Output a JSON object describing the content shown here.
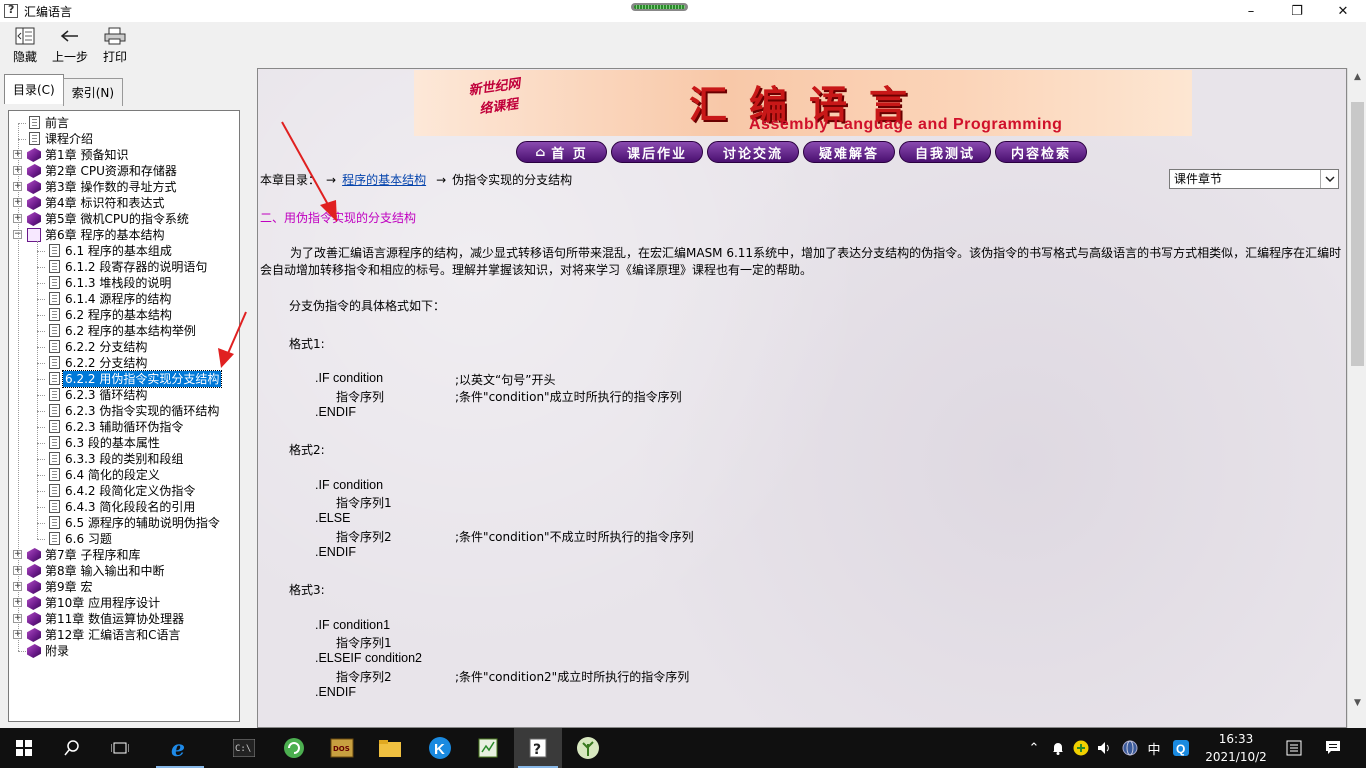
{
  "window": {
    "title": "汇编语言"
  },
  "toolbar": {
    "hide_label": "隐藏",
    "back_label": "上一步",
    "print_label": "打印"
  },
  "tabs": {
    "contents": "目录(C)",
    "index": "索引(N)"
  },
  "tree": {
    "items": [
      "前言",
      "课程介绍",
      "第1章 预备知识",
      "第2章 CPU资源和存储器",
      "第3章 操作数的寻址方式",
      "第4章 标识符和表达式",
      "第5章 微机CPU的指令系统",
      "第6章 程序的基本结构",
      "6.1 程序的基本组成",
      "6.1.2 段寄存器的说明语句",
      "6.1.3 堆栈段的说明",
      "6.1.4 源程序的结构",
      "6.2 程序的基本结构",
      "6.2 程序的基本结构举例",
      "6.2.2 分支结构",
      "6.2.2 分支结构",
      "6.2.2 用伪指令实现分支结构",
      "6.2.3 循环结构",
      "6.2.3 伪指令实现的循环结构",
      "6.2.3 辅助循环伪指令",
      "6.3 段的基本属性",
      "6.3.3 段的类别和段组",
      "6.4 简化的段定义",
      "6.4.2 段简化定义伪指令",
      "6.4.3 简化段段名的引用",
      "6.5 源程序的辅助说明伪指令",
      "6.6 习题",
      "第7章 子程序和库",
      "第8章 输入输出和中断",
      "第9章 宏",
      "第10章 应用程序设计",
      "第11章 数值运算协处理器",
      "第12章 汇编语言和C语言",
      "附录"
    ]
  },
  "banner": {
    "side_line1": "新世纪网",
    "side_line2": "络课程",
    "title": "汇编语言",
    "subtitle": "Assembly Language and Programming"
  },
  "nav": {
    "home": "首 页",
    "homework": "课后作业",
    "discussion": "讨论交流",
    "qa": "疑难解答",
    "selftest": "自我测试",
    "search": "内容检索"
  },
  "breadcrumb": {
    "prefix": "本章目录：",
    "arrow": "→",
    "link": "程序的基本结构",
    "current": "伪指令实现的分支结构"
  },
  "select": {
    "value": "课件章节"
  },
  "content": {
    "heading": "二、用伪指令实现的分支结构",
    "para1": "为了改善汇编语言源程序的结构，减少显式转移语句所带来混乱，在宏汇编MASM 6.11系统中，增加了表达分支结构的伪指令。该伪指令的书写格式与高级语言的书写方式相类似，汇编程序在汇编时会自动增加转移指令和相应的标号。理解并掌握该知识，对将来学习《编译原理》课程也有一定的帮助。",
    "intro": "分支伪指令的具体格式如下：",
    "fmt1": "格式1:",
    "fmt1_if": ".IF condition",
    "fmt1_if_comment": ";以英文“句号”开头",
    "fmt1_seq": "指令序列",
    "fmt1_seq_comment": ";条件\"condition\"成立时所执行的指令序列",
    "fmt1_endif": ".ENDIF",
    "fmt2": "格式2:",
    "fmt2_if": ".IF condition",
    "fmt2_seq1": "指令序列1",
    "fmt2_else": ".ELSE",
    "fmt2_seq2": "指令序列2",
    "fmt2_seq2_comment": ";条件\"condition\"不成立时所执行的指令序列",
    "fmt2_endif": ".ENDIF",
    "fmt3": "格式3:",
    "fmt3_if": ".IF condition1",
    "fmt3_seq1": "指令序列1",
    "fmt3_elseif": ".ELSEIF condition2",
    "fmt3_seq2": "指令序列2",
    "fmt3_seq2_comment": ";条件\"condition2\"成立时所执行的指令序列",
    "fmt3_endif": ".ENDIF"
  },
  "tray": {
    "ime": "中",
    "time": "16:33",
    "date": "2021/10/2"
  },
  "colors": {
    "selection": "#0078d7",
    "heading": "#c000c0",
    "link": "#0645ad",
    "nav_button": "#6a2a90",
    "banner_title": "#c81818"
  }
}
